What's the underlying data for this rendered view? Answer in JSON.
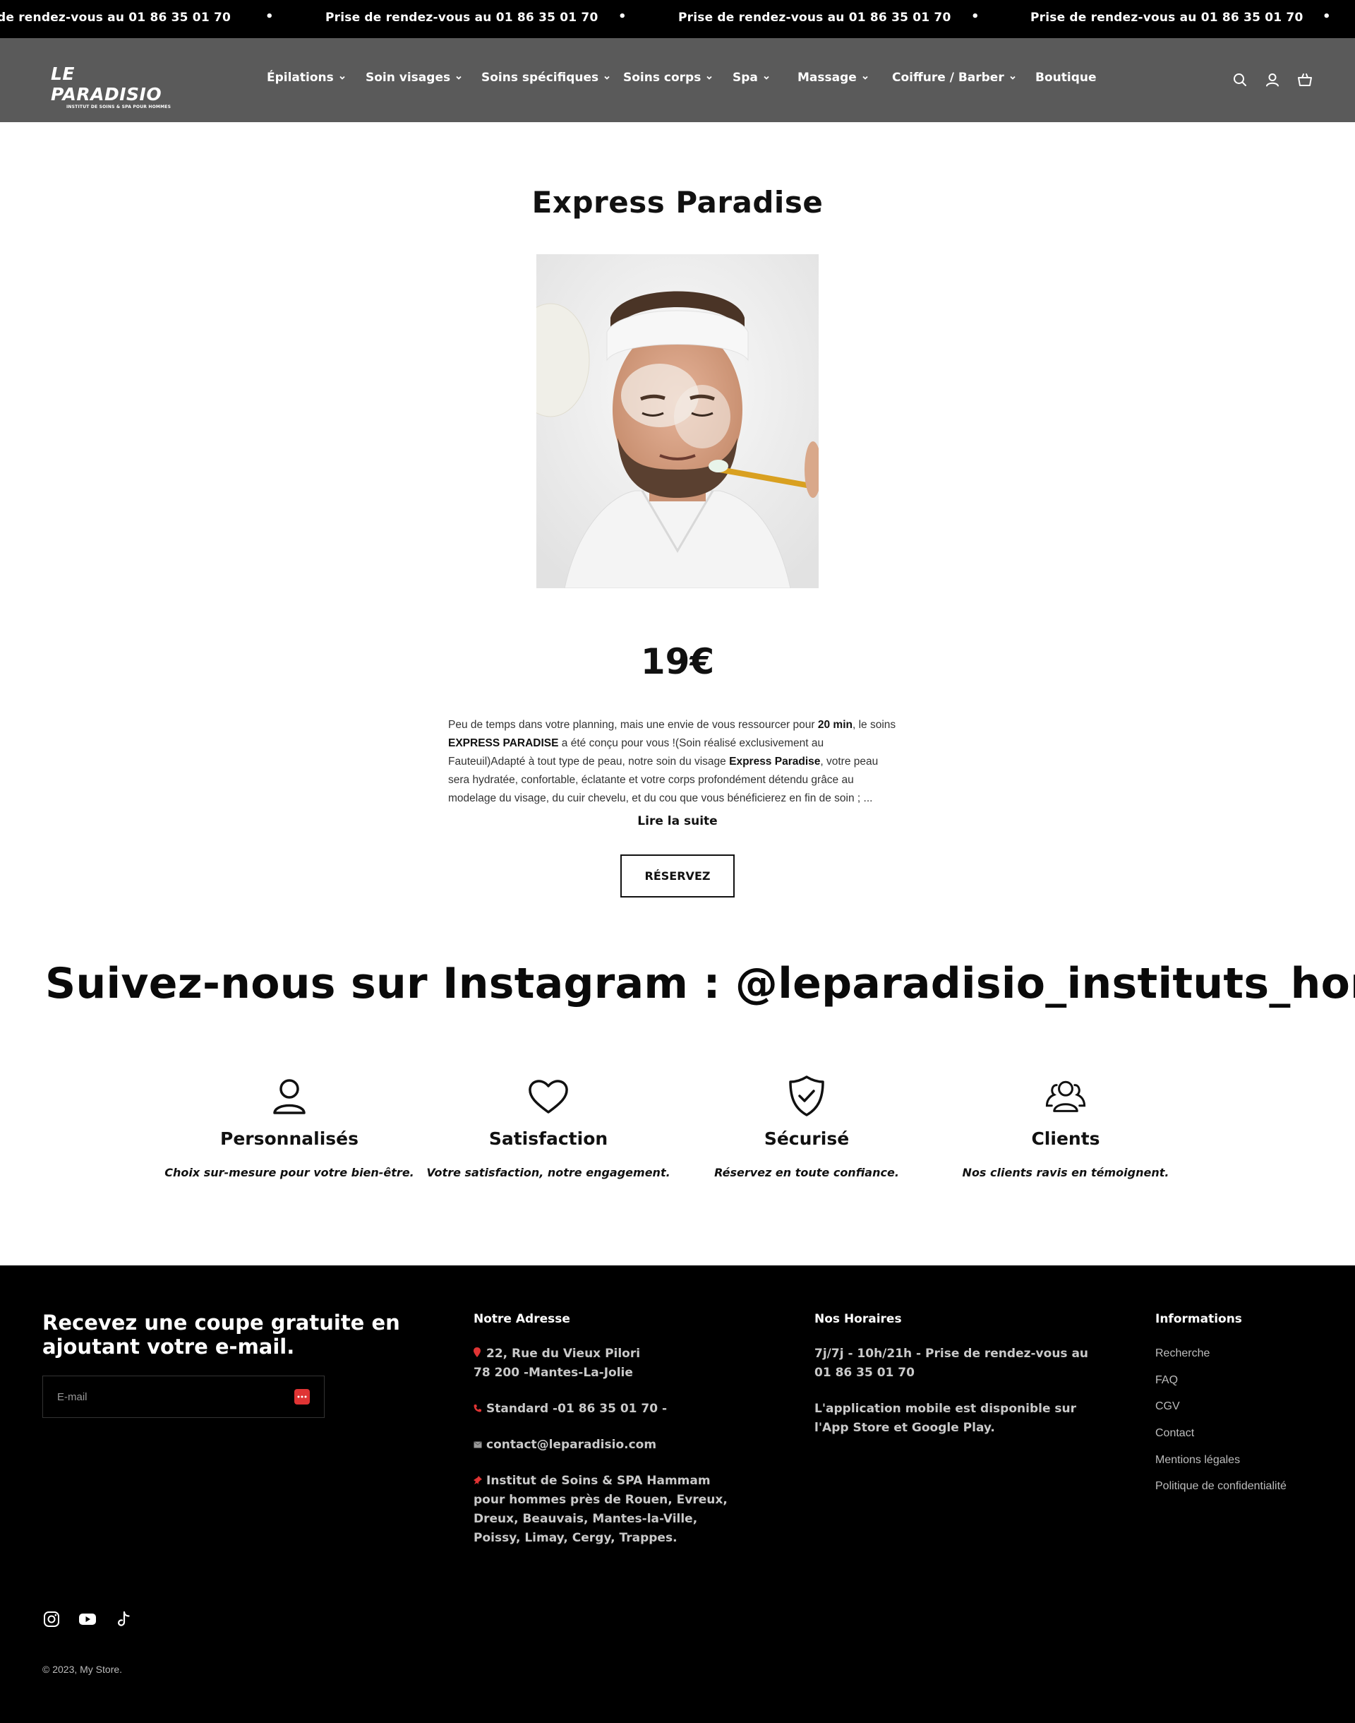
{
  "announcement": {
    "items": [
      "Prise de rendez-vous au 01 86 35 01 70",
      "Prise de rendez-vous au 01 86 35 01 70",
      "Prise de rendez-vous au 01 86 35 01 70",
      "Prise de rendez-vous au 01 86 35 01 70"
    ],
    "first_partial": "de rendez-vous au 01 86 35 01 70",
    "separator": "•"
  },
  "header": {
    "logo_text": "LE PARADISIO",
    "logo_tagline": "INSTITUT DE SOINS & SPA POUR HOMMES",
    "nav": [
      {
        "label": "Épilations",
        "has_dropdown": true
      },
      {
        "label": "Soin visages",
        "has_dropdown": true
      },
      {
        "label": "Soins spécifiques",
        "has_dropdown": true
      },
      {
        "label": "Soins corps",
        "has_dropdown": true
      },
      {
        "label": "Spa",
        "has_dropdown": true
      },
      {
        "label": "Massage",
        "has_dropdown": true
      },
      {
        "label": "Coiffure / Barber",
        "has_dropdown": true
      },
      {
        "label": "Boutique",
        "has_dropdown": false
      }
    ],
    "icons": [
      "search-icon",
      "account-icon",
      "cart-icon"
    ]
  },
  "product": {
    "title": "Express Paradise",
    "price": "19€",
    "description": {
      "p1": "Peu de temps dans votre planning, mais une envie de vous ressourcer pour ",
      "b1": "20 min",
      "p2": ", le soins ",
      "b2": "EXPRESS PARADISE",
      "p3": " a été conçu pour vous !(Soin réalisé exclusivement au Fauteuil)Adapté à tout type de peau, notre soin du visage ",
      "b3": "Express Paradise",
      "p4": ", votre peau sera hydratée, confortable, éclatante et votre corps profondément détendu grâce au modelage du visage, du cuir chevelu, et du cou que vous bénéficierez en fin de soin ; ..."
    },
    "read_more": "Lire la suite",
    "reserve_label": "RÉSERVEZ"
  },
  "instagram": {
    "heading": "Suivez-nous sur Instagram : @leparadisio_instituts_hommes"
  },
  "features": [
    {
      "icon": "user-icon",
      "title": "Personnalisés",
      "text": "Choix sur-mesure pour votre bien-être."
    },
    {
      "icon": "heart-icon",
      "title": "Satisfaction",
      "text": "Votre satisfaction, notre engagement."
    },
    {
      "icon": "shield-check-icon",
      "title": "Sécurisé",
      "text": "Réservez en toute confiance."
    },
    {
      "icon": "users-icon",
      "title": "Clients",
      "text": "Nos clients ravis en témoignent."
    }
  ],
  "footer": {
    "newsletter_title": "Recevez une coupe gratuite en ajoutant votre e-mail.",
    "email_placeholder": "E-mail",
    "address": {
      "title": "Notre Adresse",
      "line1": "22, Rue du Vieux Pilori",
      "line2": "78 200 -Mantes-La-Jolie",
      "phone": "Standard -01 86 35 01 70 -",
      "email": "contact@leparadisio.com",
      "about": "Institut de Soins & SPA Hammam pour hommes près de Rouen, Evreux, Dreux, Beauvais, Mantes-la-Ville, Poissy, Limay, Cergy, Trappes."
    },
    "hours": {
      "title": "Nos Horaires",
      "line1": "7j/7j - 10h/21h - Prise de rendez-vous au 01 86 35 01 70",
      "line2": "L'application mobile est disponible sur l'App Store et Google Play."
    },
    "info": {
      "title": "Informations",
      "links": [
        "Recherche",
        "FAQ",
        "CGV",
        "Contact",
        "Mentions légales",
        "Politique de confidentialité"
      ]
    },
    "social": [
      "instagram-icon",
      "youtube-icon",
      "tiktok-icon"
    ],
    "copyright": "© 2023, My Store."
  },
  "colors": {
    "announcement_bg": "#000000",
    "header_bg": "#5a5a5a",
    "footer_bg": "#000000",
    "accent": "#e03434"
  }
}
